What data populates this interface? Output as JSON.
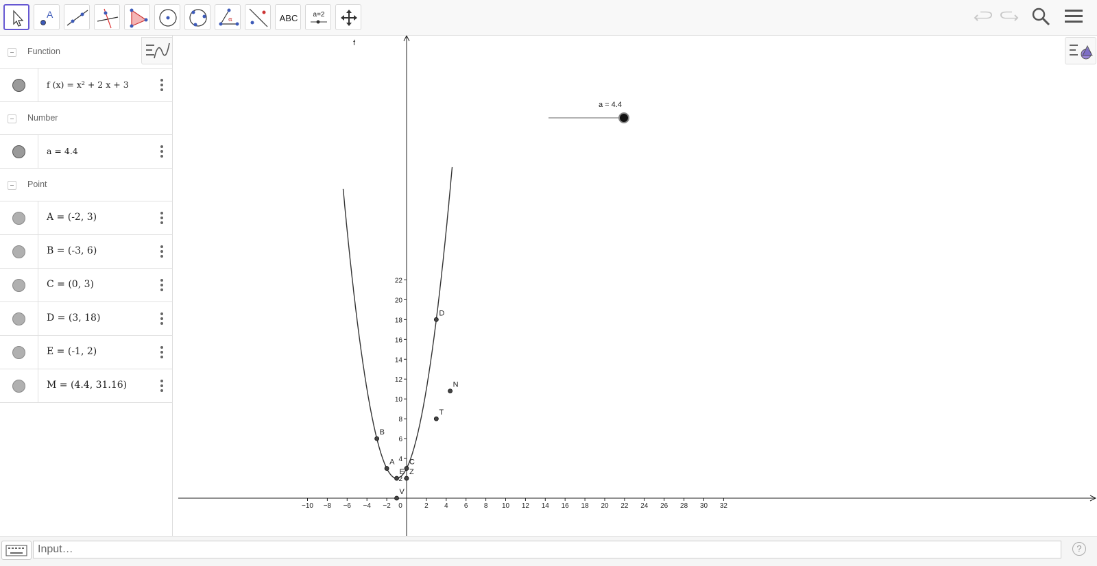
{
  "toolbar": {
    "tools": [
      {
        "name": "move-tool",
        "icon": "cursor-arrow-icon",
        "selected": true
      },
      {
        "name": "point-tool",
        "icon": "point-a-icon"
      },
      {
        "name": "line-tool",
        "icon": "line-through-two-points-icon"
      },
      {
        "name": "perpendicular-line-tool",
        "icon": "perpendicular-line-icon"
      },
      {
        "name": "polygon-tool",
        "icon": "polygon-icon"
      },
      {
        "name": "circle-tool",
        "icon": "circle-center-point-icon"
      },
      {
        "name": "circle-three-points-tool",
        "icon": "circle-three-points-icon"
      },
      {
        "name": "angle-tool",
        "icon": "angle-icon"
      },
      {
        "name": "reflect-tool",
        "icon": "reflect-about-line-icon"
      },
      {
        "name": "text-tool",
        "icon": "text-abc-icon",
        "label": "ABC"
      },
      {
        "name": "slider-tool",
        "icon": "slider-icon",
        "label": "a=2"
      },
      {
        "name": "move-graphics-view-tool",
        "icon": "move-arrows-icon"
      }
    ],
    "right_icons": [
      "undo-icon",
      "redo-icon",
      "search-icon",
      "hamburger-menu-icon"
    ]
  },
  "algebra": {
    "categories": [
      {
        "label": "Function",
        "items": [
          {
            "definition": "f (x)  =  x² + 2 x + 3"
          }
        ]
      },
      {
        "label": "Number",
        "items": [
          {
            "definition": "a = 4.4"
          }
        ]
      },
      {
        "label": "Point",
        "items": [
          {
            "definition": "A = (-2, 3)"
          },
          {
            "definition": "B = (-3, 6)"
          },
          {
            "definition": "C = (0, 3)"
          },
          {
            "definition": "D = (3, 18)"
          },
          {
            "definition": "E = (-1, 2)"
          },
          {
            "definition": "M = (4.4, 31.16)"
          }
        ]
      }
    ]
  },
  "graphics": {
    "x_ticks": [
      "−10",
      "−8",
      "−6",
      "−4",
      "−2",
      "0",
      "2",
      "4",
      "6",
      "8",
      "10",
      "12",
      "14",
      "16",
      "18",
      "20",
      "22",
      "24",
      "26",
      "28",
      "30",
      "32"
    ],
    "y_ticks": [
      "2",
      "4",
      "6",
      "8",
      "10",
      "12",
      "14",
      "16",
      "18",
      "20",
      "22"
    ],
    "function_label": "f",
    "points": [
      {
        "label": "A",
        "x": -2,
        "y": 3
      },
      {
        "label": "B",
        "x": -3,
        "y": 6
      },
      {
        "label": "C",
        "x": 0,
        "y": 3
      },
      {
        "label": "D",
        "x": 3,
        "y": 18
      },
      {
        "label": "E",
        "x": -1,
        "y": 2
      },
      {
        "label": "Z",
        "x": 0,
        "y": 2
      },
      {
        "label": "V",
        "x": -1,
        "y": 0
      },
      {
        "label": "N",
        "x": 4.4,
        "y": 10.8
      },
      {
        "label": "T",
        "x": 3,
        "y": 8
      }
    ],
    "slider": {
      "label": "a = 4.4",
      "value": 4.4
    }
  },
  "input_bar": {
    "placeholder": "Input…",
    "help_label": "?"
  }
}
